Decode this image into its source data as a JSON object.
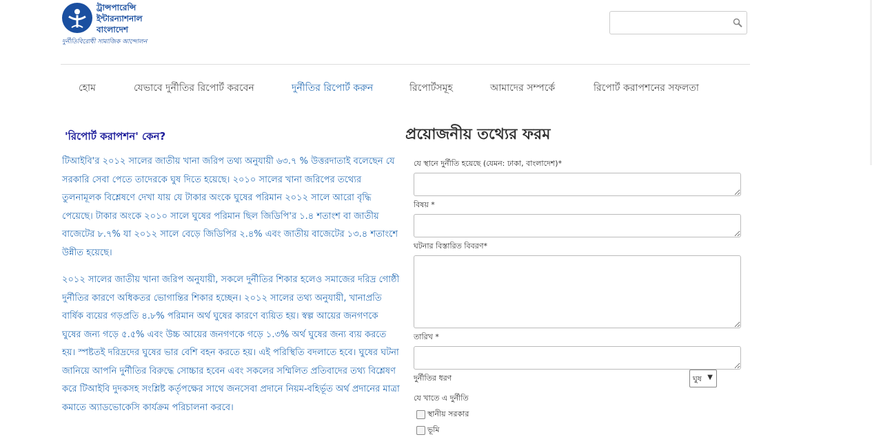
{
  "logo": {
    "line1": "ট্রান্সপারেন্সি",
    "line2": "ইন্টারন্যাশনাল",
    "line3": "বাংলাদেশ",
    "tagline": "দুর্নীতিবিরোধী সামাজিক আন্দোলন"
  },
  "search": {
    "value": "",
    "placeholder": "",
    "icon": "magnifier-icon"
  },
  "nav": [
    {
      "label": "হোম"
    },
    {
      "label": "যেভাবে দুর্নীতির রিপোর্ট করবেন"
    },
    {
      "label": "দুর্নীতির রিপোর্ট করুন"
    },
    {
      "label": "রিপোর্টসমূহ"
    },
    {
      "label": "আমাদের সম্পর্কে"
    },
    {
      "label": "রিপোর্ট করাপশনের সফলতা"
    }
  ],
  "left": {
    "title": "'রিপোর্ট করাপশন' কেন?",
    "para1": "টিআইবি'র ২০১২ সালের জাতীয় খানা জরিপ তথ্য অনুযায়ী ৬৩.৭ % উত্তরদাতাই বলেছেন যে সরকারি সেবা পেতে তাদেরকে ঘুষ দিতে হয়েছে। ২০১০ সালের খানা জরিপের তথ্যের তুলনামূলক বিশ্লেষণে দেখা যায় যে টাকার অংকে ঘুষের পরিমান ২০১২ সালে আরো বৃদ্ধি পেয়েছে। টাকার অংকে ২০১০ সালে ঘুষের পরিমান ছিল জিডিপি'র ১.৪ শতাংশ বা জাতীয় বাজেটের ৮.৭% যা ২০১২ সালে বেড়ে জিডিপির ২.৪% এবং জাতীয় বাজেটের ১৩.৪ শতাংশে উন্নীত হয়েছে।",
    "para2": "২০১২ সালের জাতীয় খানা জরিপ অনুযায়ী, সকলে দুর্নীতির শিকার হলেও সমাজের দরিদ্র গোষ্ঠী দুর্নীতির কারণে অধিকতর ভোগান্তির শিকার হচ্ছেন। ২০১২ সালের তথ্য অনুযায়ী, খানাপ্রতি বার্ষিক ব্যয়ের গড়প্রতি ৪.৮% পরিমান অর্থ ঘুষের কারণে ব্যয়িত হয়। স্বল্প আয়ের জনগণকে ঘুষের জন্য গড়ে ৫.৫% এবং উচ্চ আয়ের জনগণকে গড়ে ১.৩% অর্থ ঘুষের জন্য ব্যয় করতে হয়। স্পষ্টতই দরিদ্রদের ঘুষের ভার বেশি বহন করতে হয়। এই পরিস্থিতি বদলাতে হবে। ঘুষের ঘটনা জানিয়ে আপনি দুর্নীতির বিরুদ্ধে সোচ্চার হবেন এবং সকলের সম্মিলিত প্রতিবাদের তথ্য বিশ্লেষণ করে টিআইবি দুদকসহ সংশ্লিষ্ট কর্তৃপক্ষের সাথে জনসেবা প্রদানে নিয়ম-বহির্ভূত অর্থ প্রদানের মাত্রা কমাতে অ্যাডভোকেসি কার্যক্রম পরিচালনা করবে।"
  },
  "form": {
    "title": "প্রয়োজনীয় তথ্যের ফরম",
    "location_label": "যে স্থানে দুর্নীতি হয়েছে (যেমন: ঢাকা, বাংলাদেশ)*",
    "subject_label": "বিষয় *",
    "details_label": "ঘটনার বিস্তারিত বিবরণ*",
    "date_label": "তারিখ *",
    "type_label": "দুর্নীতির ধরণ",
    "type_selected": "ঘুষ",
    "sector_label": "যে খাতে এ দুর্নীতি",
    "sectors": [
      {
        "label": "স্থানীয় সরকার"
      },
      {
        "label": "ভূমি"
      }
    ]
  }
}
